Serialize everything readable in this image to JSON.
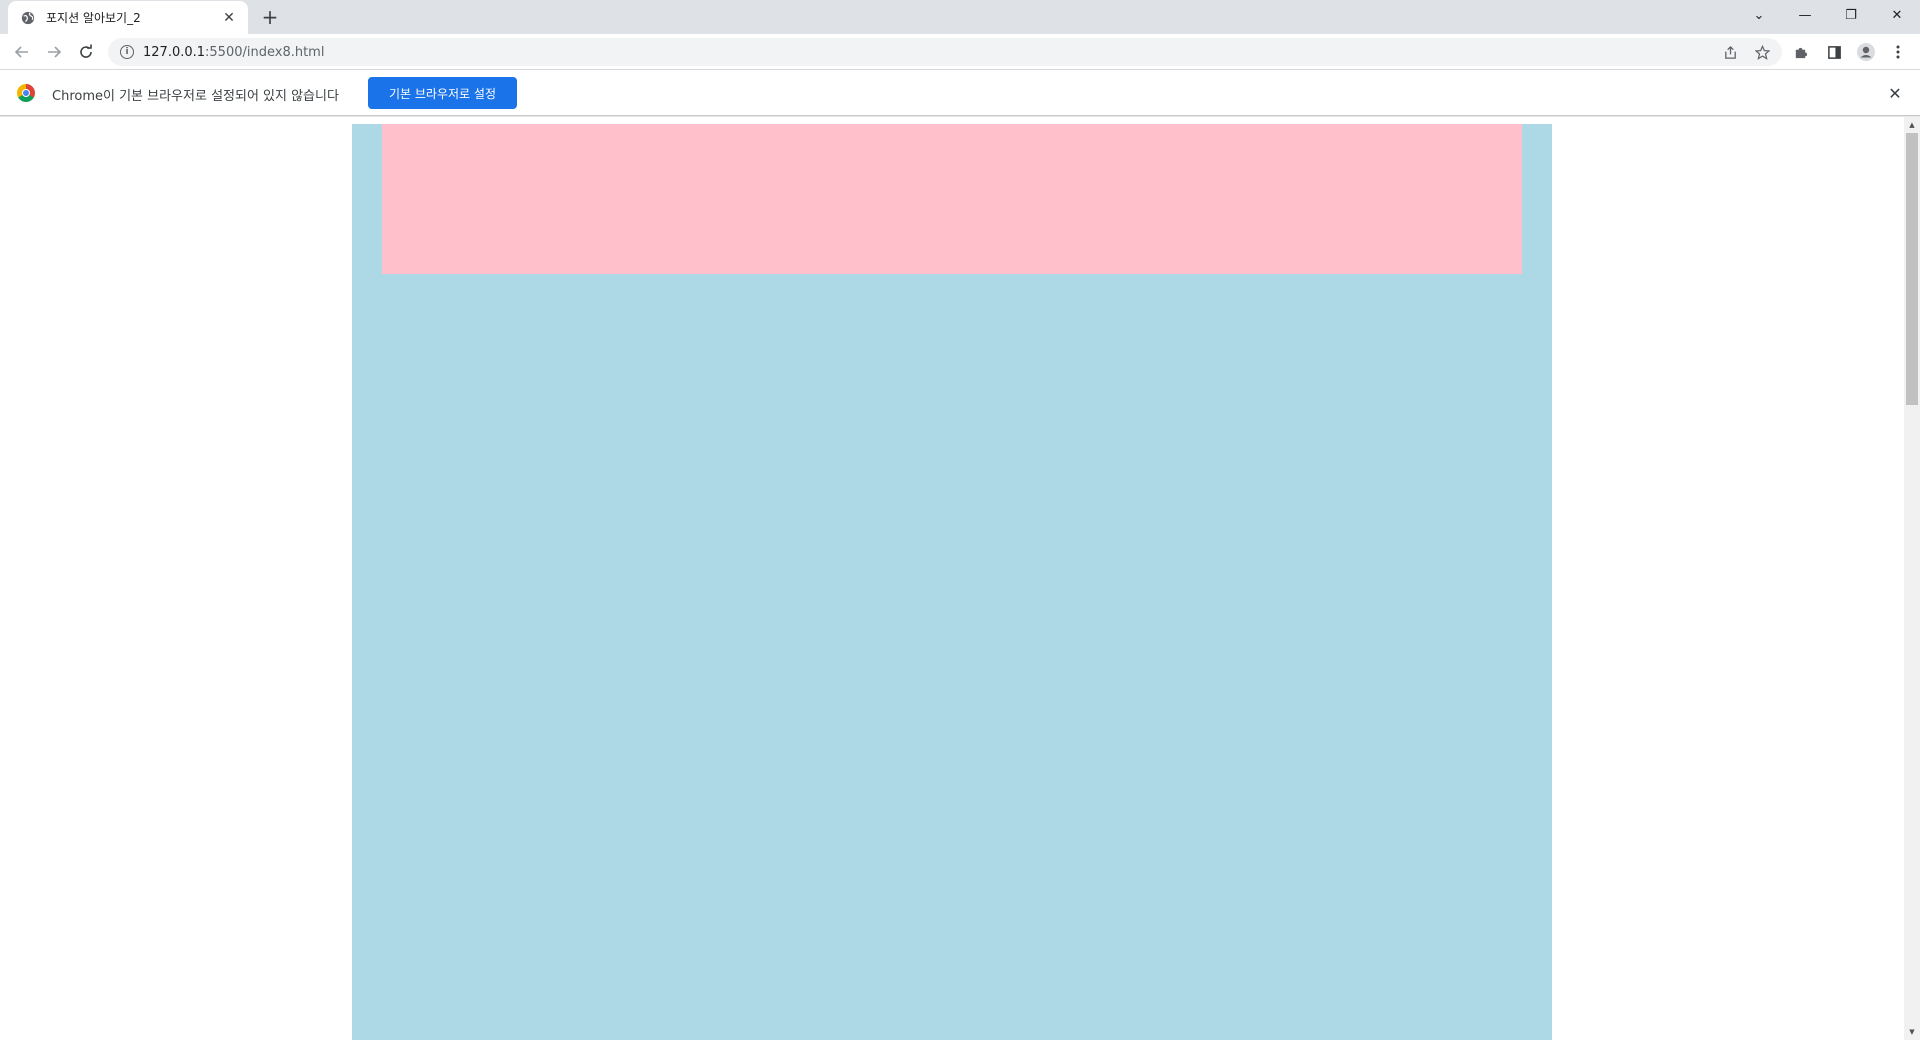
{
  "tab": {
    "title": "포지션 알아보기_2",
    "favicon": "globe-icon",
    "close_glyph": "✕"
  },
  "newtab_glyph": "+",
  "window_controls": {
    "dropdown": "⌄",
    "minimize": "—",
    "restore": "❐",
    "close": "✕"
  },
  "address_bar": {
    "host": "127.0.0.1",
    "path": ":5500/index8.html"
  },
  "infobar": {
    "message": "Chrome이 기본 브라우저로 설정되어 있지 않습니다",
    "button_label": "기본 브라우저로 설정",
    "dismiss_glyph": "✕"
  },
  "page": {
    "outer_box_color": "#add8e6",
    "inner_box_color": "#ffc0cb"
  },
  "colors": {
    "accent": "#1a73e8",
    "tabstrip": "#dee1e6"
  }
}
